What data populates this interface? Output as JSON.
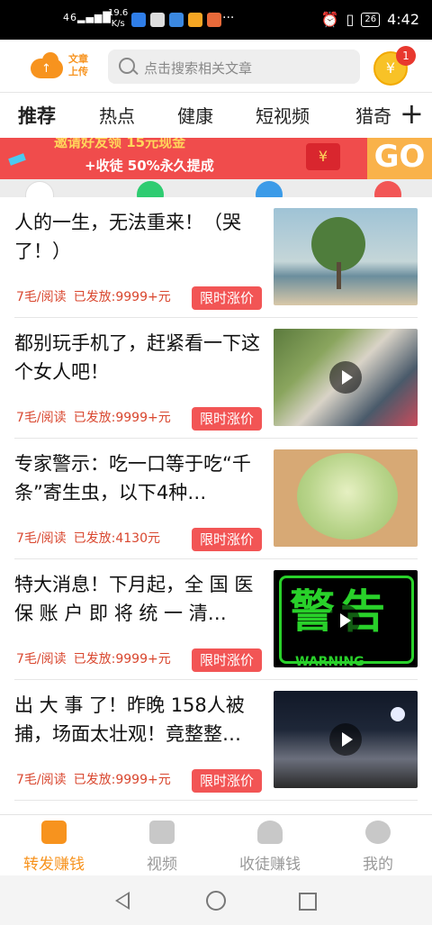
{
  "status_bar": {
    "signal": "46",
    "speed_value": "19.6",
    "speed_unit": "K/s",
    "dots": "···",
    "battery": "26",
    "time": "4:42"
  },
  "header": {
    "upload_icon": "upload-cloud-icon",
    "upload_line1": "文章",
    "upload_line2": "上传",
    "search_placeholder": "点击搜索相关文章",
    "coin_symbol": "¥",
    "coin_badge": "1"
  },
  "tabs": [
    "推荐",
    "热点",
    "健康",
    "短视频",
    "猎奇"
  ],
  "tabs_plus": "+",
  "banner": {
    "line1": "邀请好友领 15元现金",
    "line2": "+收徒 50%永久提成",
    "go": "GO",
    "gift_symbol": "¥"
  },
  "articles": [
    {
      "title": "人的一生，无法重来！（哭了！）",
      "price": "7毛/阅读",
      "paid": "已发放:9999+元",
      "tag": "限时涨价",
      "thumb": "tree-landscape",
      "video": false
    },
    {
      "title": "都别玩手机了，赶紧看一下这个女人吧！",
      "price": "7毛/阅读",
      "paid": "已发放:9999+元",
      "tag": "限时涨价",
      "thumb": "crowd-video",
      "video": true
    },
    {
      "title": "专家警示：吃一口等于吃“千条”寄生虫，以下4种…",
      "price": "7毛/阅读",
      "paid": "已发放:4130元",
      "tag": "限时涨价",
      "thumb": "cabbage",
      "video": false
    },
    {
      "title": "特大消息！下月起，全 国 医 保 账 户 即 将 统 一 清…",
      "price": "7毛/阅读",
      "paid": "已发放:9999+元",
      "tag": "限时涨价",
      "thumb": "warning-sign",
      "video": true,
      "thumb_text": "警告",
      "thumb_sub": "WARNING"
    },
    {
      "title": "出 大 事 了！昨晚 158人被捕，场面太壮观！竟整整…",
      "price": "7毛/阅读",
      "paid": "已发放:9999+元",
      "tag": "限时涨价",
      "thumb": "night-crowd",
      "video": true
    }
  ],
  "bottom_nav": [
    {
      "label": "转发赚钱",
      "icon": "share-earn-icon",
      "active": true
    },
    {
      "label": "视频",
      "icon": "video-icon",
      "active": false
    },
    {
      "label": "收徒赚钱",
      "icon": "invite-user-icon",
      "active": false
    },
    {
      "label": "我的",
      "icon": "profile-icon",
      "active": false
    }
  ],
  "colors": {
    "accent": "#f7931e",
    "tag_red": "#f25555",
    "meta_red": "#d9472f"
  }
}
